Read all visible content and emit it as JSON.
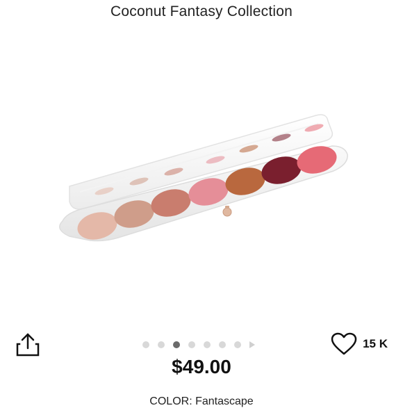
{
  "product": {
    "title_partial": "",
    "subtitle": "Coconut Fantasy Collection",
    "price": "$49.00",
    "color_label": "COLOR: Fantascape"
  },
  "gallery": {
    "total_images": 7,
    "active_index": 3
  },
  "likes": {
    "count": "15 K"
  },
  "palette": {
    "shades": [
      "#e4b8a8",
      "#cf9d8a",
      "#c97d6e",
      "#e58e98",
      "#b9683e",
      "#7a1f2e",
      "#e66a76"
    ],
    "case_color": "#ffffff",
    "clasp_color": "#e0b8a0"
  }
}
